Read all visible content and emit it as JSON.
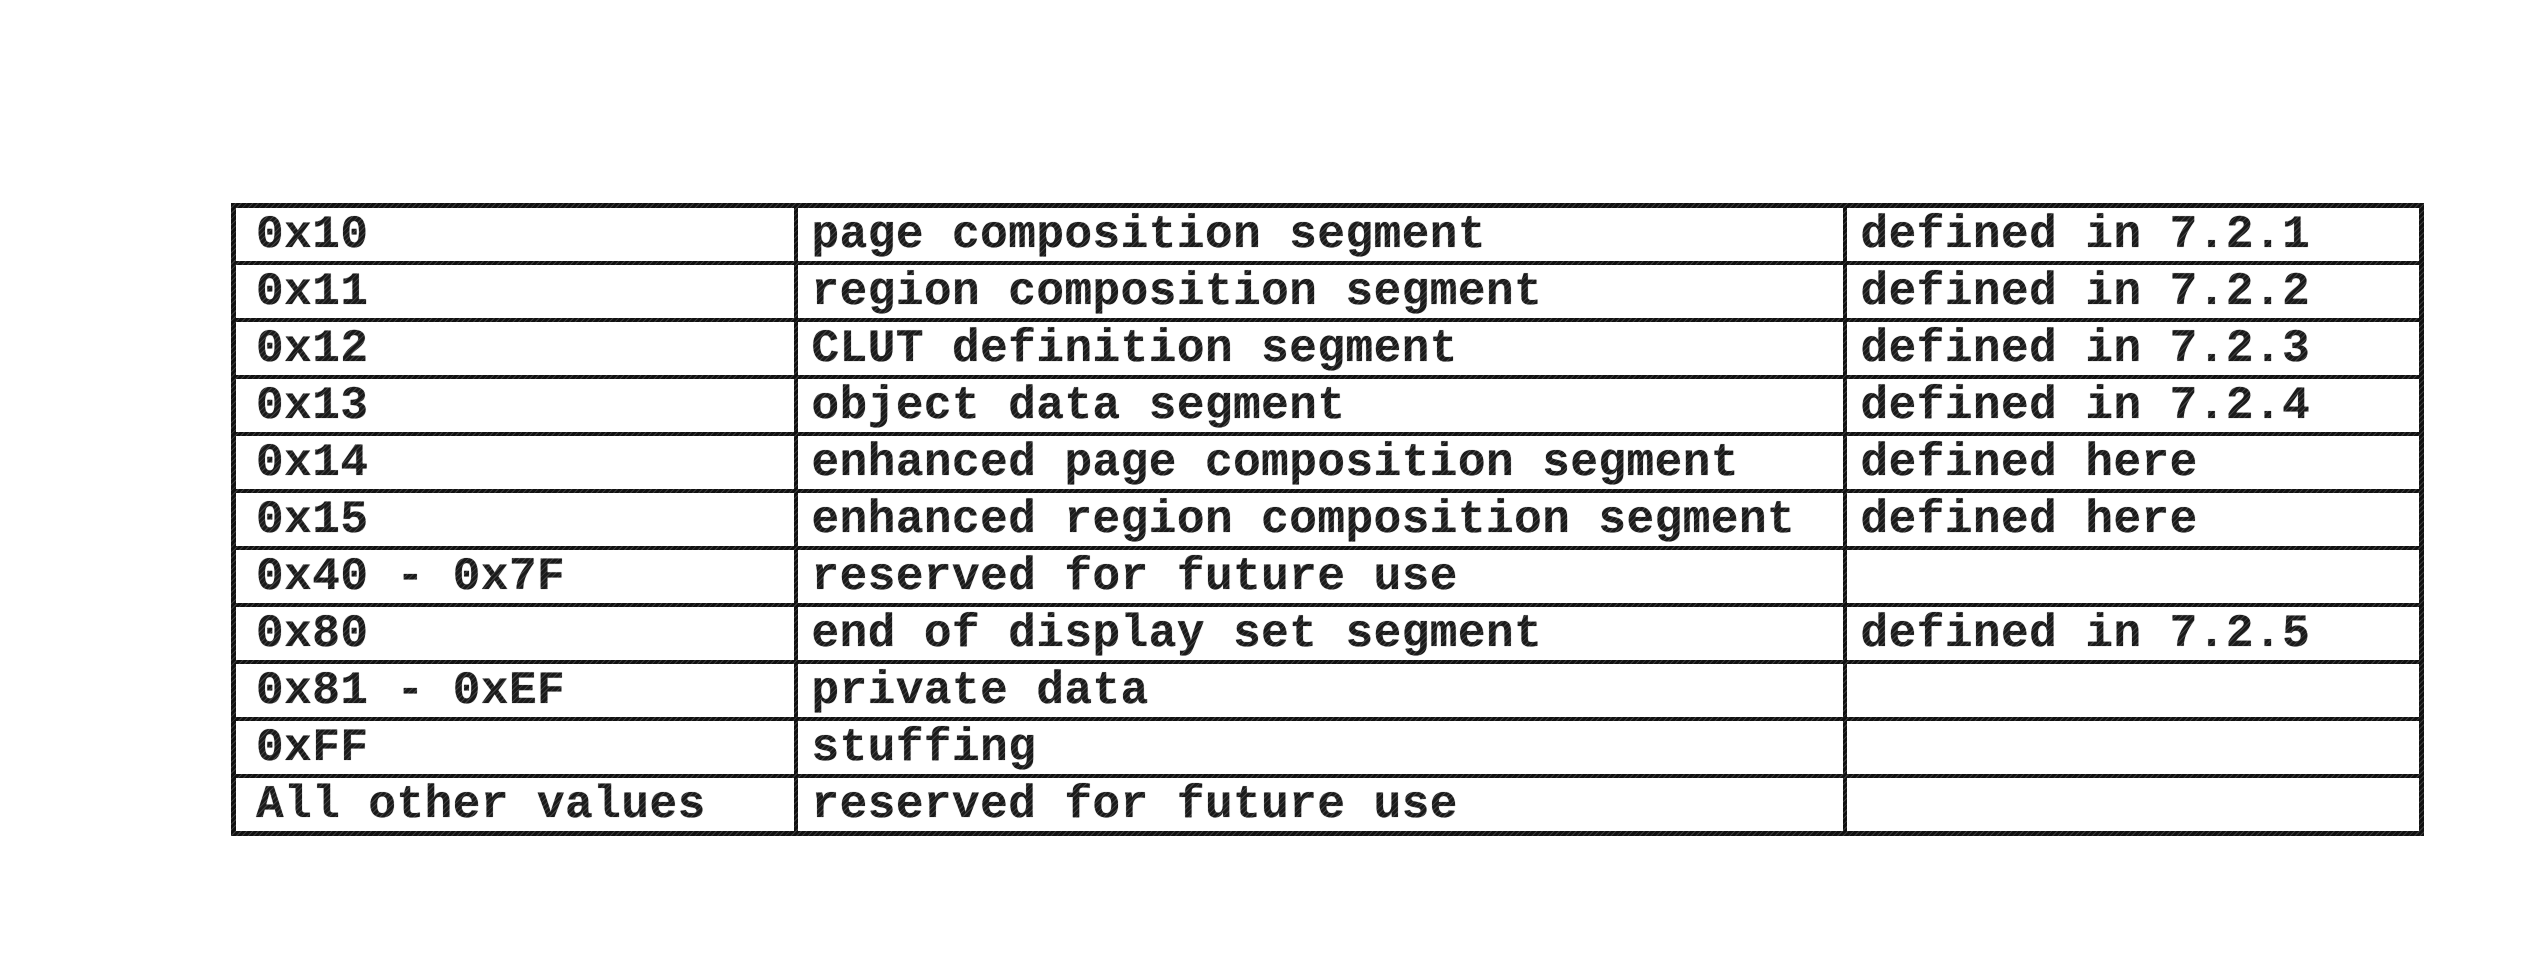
{
  "table": {
    "rows": [
      {
        "value": "0x10",
        "segment_type": "page composition segment",
        "definition": "defined in 7.2.1"
      },
      {
        "value": "0x11",
        "segment_type": "region composition segment",
        "definition": "defined in 7.2.2"
      },
      {
        "value": "0x12",
        "segment_type": "CLUT definition segment",
        "definition": "defined in 7.2.3"
      },
      {
        "value": "0x13",
        "segment_type": "object data segment",
        "definition": "defined in 7.2.4"
      },
      {
        "value": "0x14",
        "segment_type": "enhanced page composition segment",
        "definition": "defined here"
      },
      {
        "value": "0x15",
        "segment_type": "enhanced region composition segment",
        "definition": "defined here"
      },
      {
        "value": "0x40 - 0x7F",
        "segment_type": "reserved for future use",
        "definition": ""
      },
      {
        "value": "0x80",
        "segment_type": "end of display set segment",
        "definition": "defined in 7.2.5"
      },
      {
        "value": "0x81 - 0xEF",
        "segment_type": "private data",
        "definition": ""
      },
      {
        "value": "0xFF",
        "segment_type": "stuffing",
        "definition": ""
      },
      {
        "value": "All other values",
        "segment_type": "reserved for future use",
        "definition": ""
      }
    ]
  }
}
